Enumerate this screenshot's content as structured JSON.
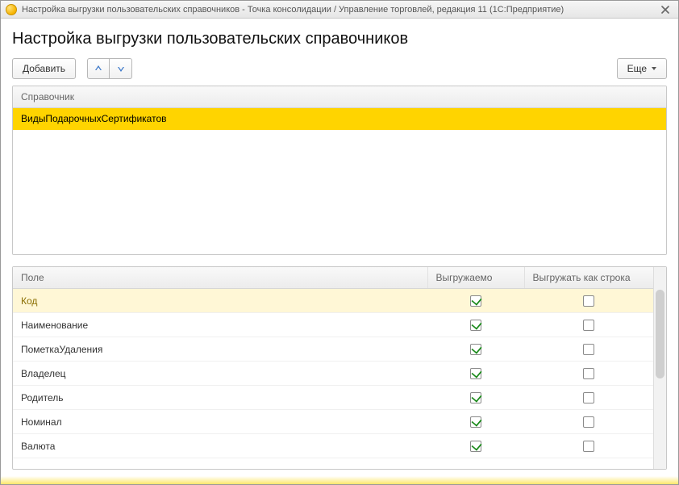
{
  "window": {
    "title": "Настройка выгрузки пользовательских справочников - Точка консолидации / Управление торговлей, редакция 11  (1С:Предприятие)"
  },
  "page": {
    "heading": "Настройка выгрузки пользовательских справочников"
  },
  "toolbar": {
    "add_label": "Добавить",
    "more_label": "Еще"
  },
  "catalog_list": {
    "header": "Справочник",
    "items": [
      {
        "label": "ВидыПодарочныхСертификатов",
        "selected": true
      }
    ]
  },
  "fields_table": {
    "columns": {
      "field": "Поле",
      "exportable": "Выгружаемо",
      "as_string": "Выгружать как строка"
    },
    "rows": [
      {
        "field": "Код",
        "exportable": true,
        "as_string": false,
        "highlight": true
      },
      {
        "field": "Наименование",
        "exportable": true,
        "as_string": false
      },
      {
        "field": "ПометкаУдаления",
        "exportable": true,
        "as_string": false
      },
      {
        "field": "Владелец",
        "exportable": true,
        "as_string": false
      },
      {
        "field": "Родитель",
        "exportable": true,
        "as_string": false
      },
      {
        "field": "Номинал",
        "exportable": true,
        "as_string": false
      },
      {
        "field": "Валюта",
        "exportable": true,
        "as_string": false
      }
    ]
  }
}
